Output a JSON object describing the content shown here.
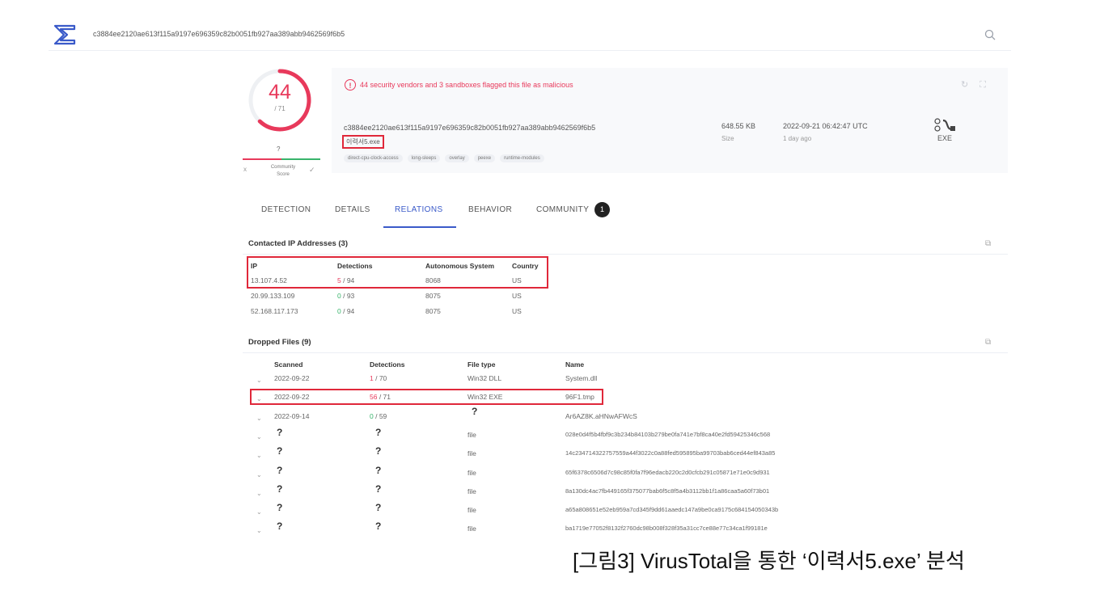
{
  "header": {
    "hash": "c3884ee2120ae613f115a9197e696359c82b0051fb927aa389abb9462569f6b5",
    "logo_icon": "virustotal-sigma-logo-icon",
    "search_icon": "search-icon"
  },
  "score": {
    "detections": "44",
    "total": "/ 71",
    "community_value": "?",
    "community_label_1": "Community",
    "community_label_2": "Score",
    "reject_icon": "x",
    "accept_icon": "✓"
  },
  "summary": {
    "warning": "44 security vendors and 3 sandboxes flagged this file as malicious",
    "hash": "c3884ee2120ae613f115a9197e696359c82b0051fb927aa389abb9462569f6b5",
    "filename": "이력서5.exe",
    "tags": [
      "direct-cpu-clock-access",
      "long-sleeps",
      "overlay",
      "peexe",
      "runtime-modules"
    ],
    "size": "648.55 KB",
    "size_label": "Size",
    "date": "2022-09-21 06:42:47 UTC",
    "date_relative": "1 day ago",
    "file_type": "EXE",
    "reanalyze_icon": "↻",
    "graph_icon": "⛶"
  },
  "tabs": [
    {
      "label": "DETECTION"
    },
    {
      "label": "DETAILS"
    },
    {
      "label": "RELATIONS"
    },
    {
      "label": "BEHAVIOR"
    },
    {
      "label": "COMMUNITY"
    }
  ],
  "community_badge": "1",
  "contacted_ips": {
    "title": "Contacted IP Addresses (3)",
    "columns": [
      "IP",
      "Detections",
      "Autonomous System",
      "Country"
    ],
    "rows": [
      {
        "ip": "13.107.4.52",
        "det_hit": "5",
        "det_total": " / 94",
        "asn": "8068",
        "country": "US"
      },
      {
        "ip": "20.99.133.109",
        "det_hit": "0",
        "det_total": " / 93",
        "asn": "8075",
        "country": "US"
      },
      {
        "ip": "52.168.117.173",
        "det_hit": "0",
        "det_total": " / 94",
        "asn": "8075",
        "country": "US"
      }
    ]
  },
  "dropped_files": {
    "title": "Dropped Files (9)",
    "columns": [
      "Scanned",
      "Detections",
      "File type",
      "Name"
    ],
    "rows": [
      {
        "scanned": "2022-09-22",
        "det_hit": "1",
        "det_total": " / 70",
        "type": "Win32 DLL",
        "name": "System.dll"
      },
      {
        "scanned": "2022-09-22",
        "det_hit": "56",
        "det_total": " / 71",
        "type": "Win32 EXE",
        "name": "96F1.tmp"
      },
      {
        "scanned": "2022-09-14",
        "det_hit": "0",
        "det_total": " / 59",
        "type": "?",
        "name": "Ar6AZ8K.aHNwAFWcS"
      },
      {
        "scanned": "?",
        "det_hit": "?",
        "det_total": "",
        "type": "file",
        "name": "028e0d4f5b4fbf9c3b234b84103b279be0fa741e7bf8ca40e2fd59425346c568"
      },
      {
        "scanned": "?",
        "det_hit": "?",
        "det_total": "",
        "type": "file",
        "name": "14c234714322757559a44f3022c0a88fed595895ba99703bab6ced44ef843a85"
      },
      {
        "scanned": "?",
        "det_hit": "?",
        "det_total": "",
        "type": "file",
        "name": "65f6378c6506d7c98c85f0fa7f96edacb220c2d0cfcb291c05871e71e0c9d931"
      },
      {
        "scanned": "?",
        "det_hit": "?",
        "det_total": "",
        "type": "file",
        "name": "8a130dc4ac7fb449165f375077bab6f5c8f5a4b3112bb1f1a86caa5a60f73b01"
      },
      {
        "scanned": "?",
        "det_hit": "?",
        "det_total": "",
        "type": "file",
        "name": "a65a808651e52eb959a7cd345f9dd61aaedc147a9be0ca9175c684154050343b"
      },
      {
        "scanned": "?",
        "det_hit": "?",
        "det_total": "",
        "type": "file",
        "name": "ba1719e77052f8132f2760dc98b008f328f35a31cc7ce88e77c34ca1f99181e"
      }
    ]
  },
  "caption": "[그림3] VirusTotal을 통한 ‘이력서5.exe’ 분석",
  "colors": {
    "accent": "#3a5ac9",
    "malicious": "#e8395b",
    "clean": "#38b46b",
    "highlight_box": "#e0283a"
  }
}
